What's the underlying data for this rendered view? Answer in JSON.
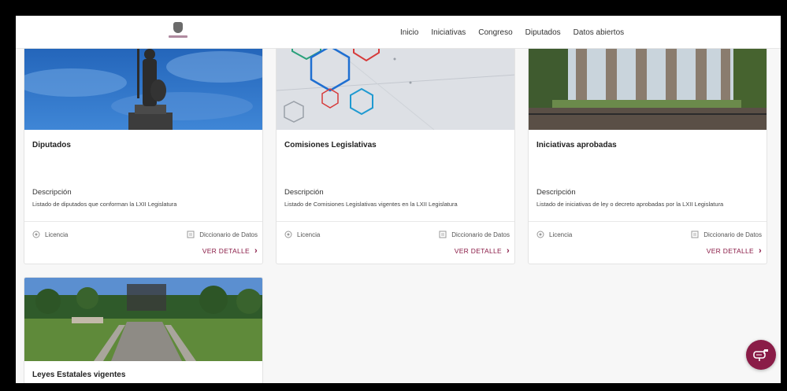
{
  "nav": {
    "items": [
      "Inicio",
      "Iniciativas",
      "Congreso",
      "Diputados",
      "Datos abiertos"
    ]
  },
  "cards": [
    {
      "title": "Diputados",
      "desc_label": "Descripción",
      "desc": "Listado de diputados que conforman la LXII Legislatura",
      "licencia": "Licencia",
      "diccionario": "Diccionario de Datos",
      "ver": "VER DETALLE"
    },
    {
      "title": "Comisiones Legislativas",
      "desc_label": "Descripción",
      "desc": "Listado de Comisiones Legislativas vigentes en la LXII Legislatura",
      "licencia": "Licencia",
      "diccionario": "Diccionario de Datos",
      "ver": "VER DETALLE"
    },
    {
      "title": "Iniciativas aprobadas",
      "desc_label": "Descripción",
      "desc": "Listado de iniciativas de ley o decreto aprobadas por la LXII Legislatura",
      "licencia": "Licencia",
      "diccionario": "Diccionario de Datos",
      "ver": "VER DETALLE"
    },
    {
      "title": "Leyes Estatales vigentes"
    }
  ],
  "colors": {
    "accent": "#8a1c47",
    "sky": "#2f6fc1"
  },
  "icons": {
    "licencia": "creative-commons-icon",
    "diccionario": "document-icon",
    "ver": "chevron-right-icon",
    "fab": "mailbox-icon"
  }
}
